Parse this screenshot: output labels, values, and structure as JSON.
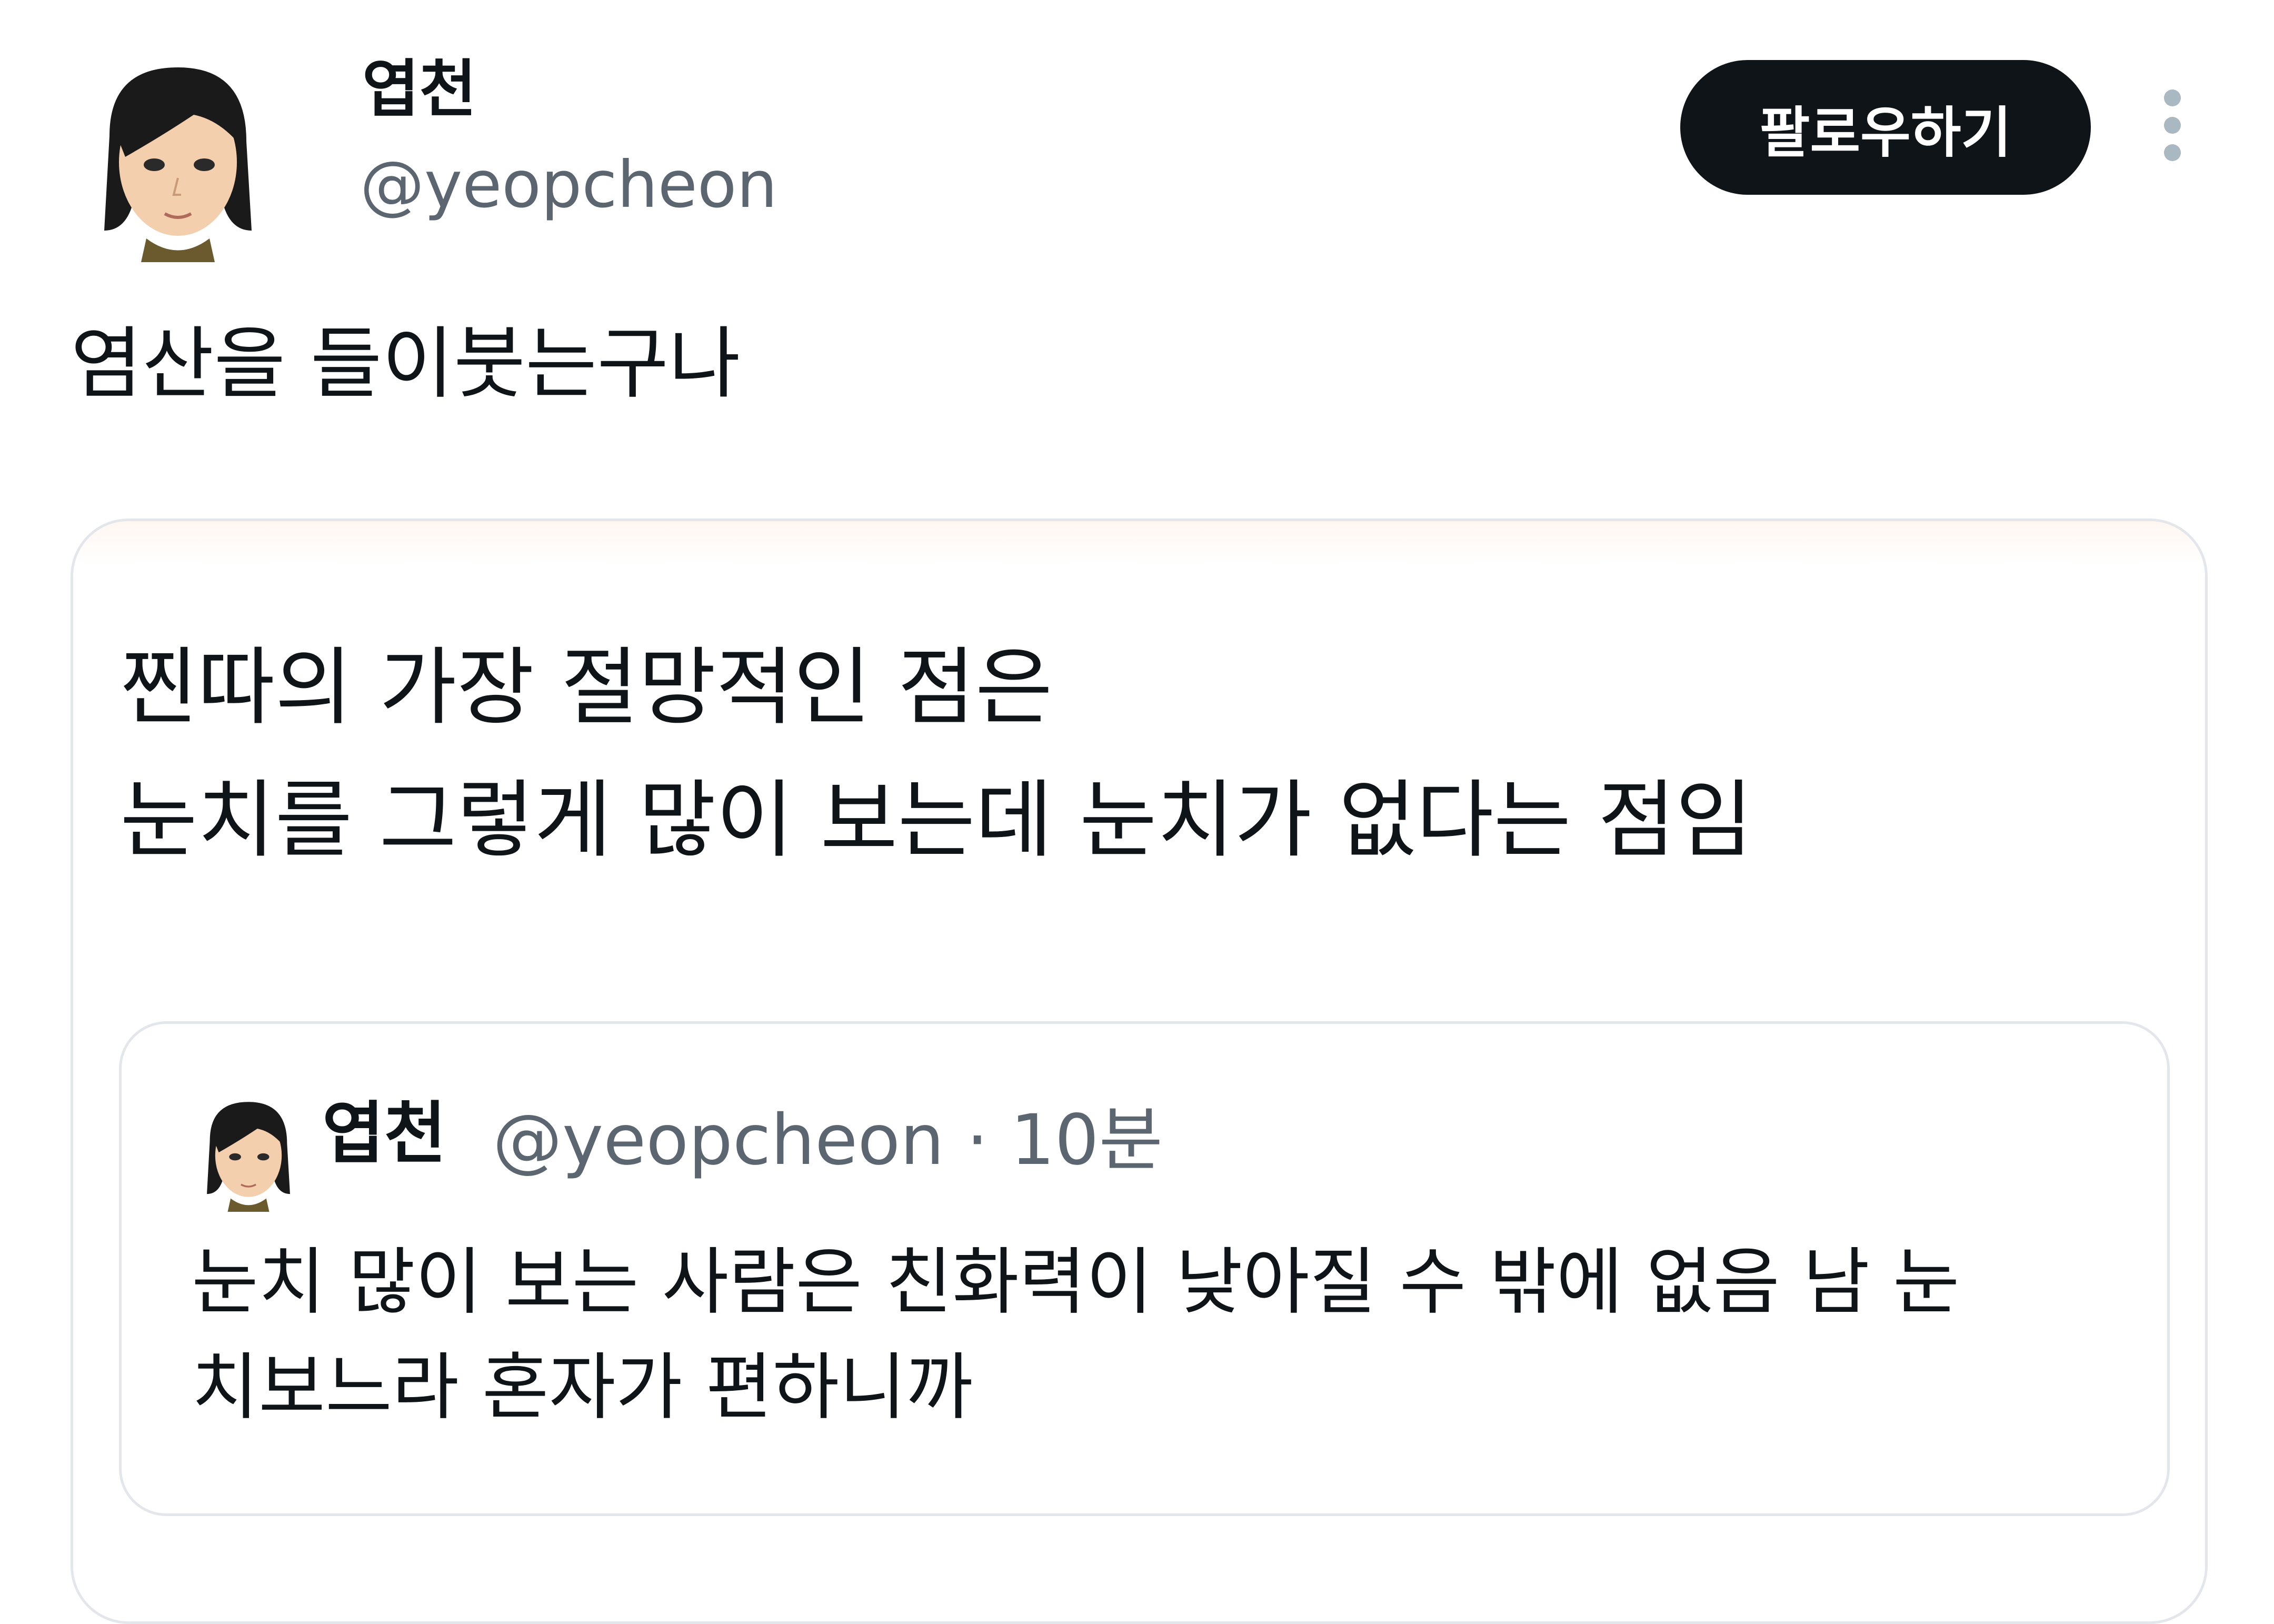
{
  "header": {
    "display_name": "엽천",
    "handle": "@yeopcheon",
    "follow_label": "팔로우하기",
    "more_icon": "vertical-ellipsis-icon"
  },
  "tweet": {
    "text": "염산을 들이붓는구나"
  },
  "quoted_tweet": {
    "line1": "찐따의 가장 절망적인 점은",
    "line2": "눈치를 그렇게 많이 보는데 눈치가 없다는 점임",
    "inner_quote": {
      "display_name": "엽천",
      "handle": "@yeopcheon",
      "separator": "·",
      "time": "10분",
      "line1": "눈치 많이 보는 사람은 친화력이 낮아질 수 밖에 없음 남 눈",
      "line2": "치보느라 혼자가 편하니까"
    }
  },
  "colors": {
    "follow_button_bg": "#0f1419",
    "secondary_text": "#5b6670",
    "card_border": "#e3e7eb"
  }
}
